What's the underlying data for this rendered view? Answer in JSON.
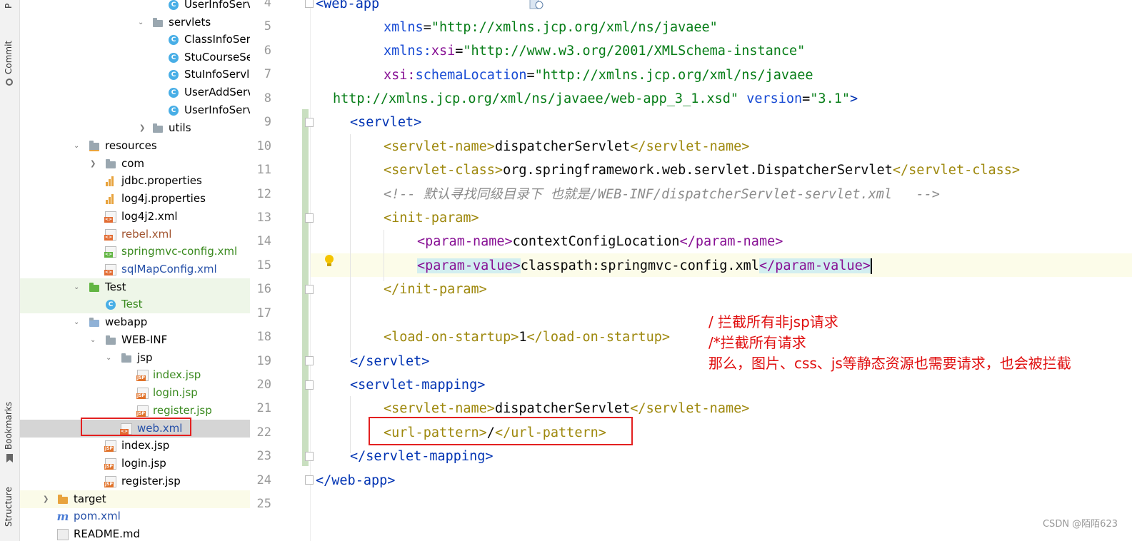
{
  "sidebar_labels": {
    "project": "P",
    "commit": "Commit",
    "bookmarks": "Bookmarks",
    "structure": "Structure"
  },
  "tree": {
    "items": [
      {
        "label": "UserInfoServ",
        "icon": "class-icon",
        "color": "#1f1f1f"
      },
      {
        "label": "servlets",
        "icon": "folder-icon",
        "color": "#1f1f1f"
      },
      {
        "label": "ClassInfoServ",
        "icon": "class-icon",
        "color": "#1f1f1f"
      },
      {
        "label": "StuCourseSe",
        "icon": "class-icon",
        "color": "#1f1f1f"
      },
      {
        "label": "StuInfoServle",
        "icon": "class-icon",
        "color": "#1f1f1f"
      },
      {
        "label": "UserAddServ",
        "icon": "class-icon",
        "color": "#1f1f1f"
      },
      {
        "label": "UserInfoServ",
        "icon": "class-icon",
        "color": "#1f1f1f"
      },
      {
        "label": "utils",
        "icon": "folder-icon",
        "color": "#1f1f1f"
      },
      {
        "label": "resources",
        "icon": "resources-folder-icon",
        "color": "#1f1f1f"
      },
      {
        "label": "com",
        "icon": "folder-icon",
        "color": "#1f1f1f"
      },
      {
        "label": "jdbc.properties",
        "icon": "properties-icon",
        "color": "#1f1f1f"
      },
      {
        "label": "log4j.properties",
        "icon": "properties-icon",
        "color": "#1f1f1f"
      },
      {
        "label": "log4j2.xml",
        "icon": "xml-icon",
        "color": "#1f1f1f"
      },
      {
        "label": "rebel.xml",
        "icon": "xml-icon",
        "color": "#a0522d"
      },
      {
        "label": "springmvc-config.xml",
        "icon": "spring-xml-icon",
        "color": "#3a8a1f"
      },
      {
        "label": "sqlMapConfig.xml",
        "icon": "xml-icon",
        "color": "#2650a8"
      },
      {
        "label": "Test",
        "icon": "test-folder-icon",
        "color": "#1f1f1f"
      },
      {
        "label": "Test",
        "icon": "test-class-icon",
        "color": "#3a8a1f"
      },
      {
        "label": "webapp",
        "icon": "web-folder-icon",
        "color": "#1f1f1f"
      },
      {
        "label": "WEB-INF",
        "icon": "folder-icon",
        "color": "#1f1f1f"
      },
      {
        "label": "jsp",
        "icon": "folder-icon",
        "color": "#1f1f1f"
      },
      {
        "label": "index.jsp",
        "icon": "jsp-icon",
        "color": "#3a8a1f"
      },
      {
        "label": "login.jsp",
        "icon": "jsp-icon",
        "color": "#3a8a1f"
      },
      {
        "label": "register.jsp",
        "icon": "jsp-icon",
        "color": "#3a8a1f"
      },
      {
        "label": "web.xml",
        "icon": "web-xml-icon",
        "color": "#2650a8"
      },
      {
        "label": "index.jsp",
        "icon": "jsp-icon",
        "color": "#1f1f1f"
      },
      {
        "label": "login.jsp",
        "icon": "jsp-icon",
        "color": "#1f1f1f"
      },
      {
        "label": "register.jsp",
        "icon": "jsp-icon",
        "color": "#1f1f1f"
      },
      {
        "label": "target",
        "icon": "excluded-folder-icon",
        "color": "#1f1f1f"
      },
      {
        "label": "pom.xml",
        "icon": "maven-icon",
        "color": "#2650a8"
      },
      {
        "label": "README.md",
        "icon": "markdown-icon",
        "color": "#1f1f1f"
      }
    ]
  },
  "editor": {
    "line_numbers": [
      "4",
      "5",
      "6",
      "7",
      "8",
      "9",
      "10",
      "11",
      "12",
      "13",
      "14",
      "15",
      "16",
      "17",
      "18",
      "19",
      "20",
      "21",
      "22",
      "23",
      "24",
      "25"
    ],
    "code": {
      "l4": "<web-app",
      "l5_attr": "xmlns",
      "l5_val": "\"http://xmlns.jcp.org/xml/ns/javaee\"",
      "l6_ns": "xmlns:",
      "l6_attr": "xsi",
      "l6_val": "\"http://www.w3.org/2001/XMLSchema-instance\"",
      "l7_ns": "xsi:",
      "l7_attr": "schemaLocation",
      "l7_val": "\"http://xmlns.jcp.org/xml/ns/javaee",
      "l8_val": "http://xmlns.jcp.org/xml/ns/javaee/web-app_3_1.xsd\"",
      "l8_attr": "version",
      "l8_val2": "\"3.1\"",
      "l9": "<servlet>",
      "l10_open": "<servlet-name>",
      "l10_text": "dispatcherServlet",
      "l10_close": "</servlet-name>",
      "l11_open": "<servlet-class>",
      "l11_text": "org.springframework.web.servlet.DispatcherServlet",
      "l11_close": "</servlet-class>",
      "l12": "<!-- 默认寻找同级目录下 也就是/WEB-INF/dispatcherServlet-servlet.xml   -->",
      "l13": "<init-param>",
      "l14_open": "<param-name>",
      "l14_text": "contextConfigLocation",
      "l14_close": "</param-name>",
      "l15_open": "<param-value>",
      "l15_text": "classpath:springmvc-config.xml",
      "l15_close": "</param-value>",
      "l16": "</init-param>",
      "l18_open": "<load-on-startup>",
      "l18_text": "1",
      "l18_close": "</load-on-startup>",
      "l19": "</servlet>",
      "l20": "<servlet-mapping>",
      "l21_open": "<servlet-name>",
      "l21_text": "dispatcherServlet",
      "l21_close": "</servlet-name>",
      "l22_open": "<url-pattern>",
      "l22_text": "/",
      "l22_close": "</url-pattern>",
      "l23": "</servlet-mapping>",
      "l24": "</web-app>"
    }
  },
  "annotation": {
    "line1": "/ 拦截所有非jsp请求",
    "line2": "/*拦截所有请求",
    "line3": "那么，图片、css、js等静态资源也需要请求，也会被拦截"
  },
  "watermark": "CSDN @陌陌623",
  "colors": {
    "tag": "#0033b3",
    "string": "#067d17",
    "yellow_tag": "#9e880d",
    "annotation_red": "#e00f0f",
    "highlight_box": "#e32020"
  }
}
